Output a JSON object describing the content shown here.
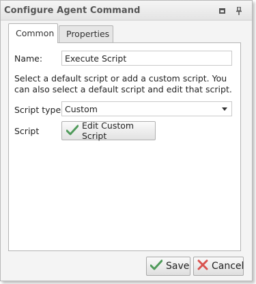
{
  "dialog": {
    "title": "Configure Agent Command",
    "icons": [
      "restore-icon",
      "pin-icon"
    ]
  },
  "tabs": [
    {
      "label": "Common",
      "active": true
    },
    {
      "label": "Properties",
      "active": false
    }
  ],
  "form": {
    "name_label": "Name:",
    "name_value": "Execute Script",
    "info_text": "Select a default script or add a custom script. You can also select a default script and edit that script.",
    "script_type_label": "Script type",
    "script_type_value": "Custom",
    "script_label": "Script",
    "edit_button_label": "Edit Custom Script"
  },
  "footer": {
    "save_label": "Save",
    "cancel_label": "Cancel"
  },
  "colors": {
    "check_green": "#4f9a5a",
    "cancel_red": "#d9534f"
  }
}
